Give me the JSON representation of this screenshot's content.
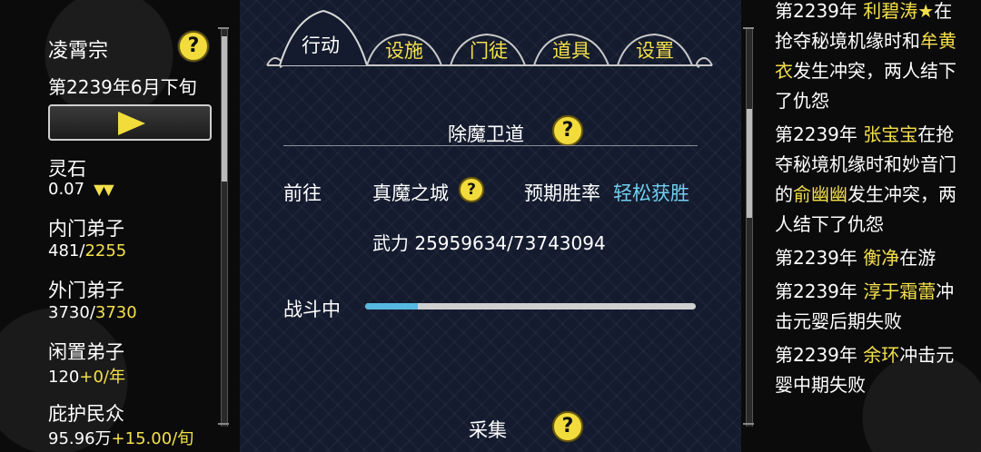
{
  "sidebar": {
    "sect_name": "凌霄宗",
    "date": "第2239年6月下旬",
    "stats": [
      {
        "label": "灵石",
        "value": "0.07",
        "extra": "▼▼"
      },
      {
        "label": "内门弟子",
        "current": "481",
        "sep": "/",
        "max": "2255"
      },
      {
        "label": "外门弟子",
        "current": "3730",
        "sep": "/",
        "max": "3730"
      },
      {
        "label": "闲置弟子",
        "current": "120",
        "delta": "+0/年"
      },
      {
        "label": "庇护民众",
        "current": "95.96万",
        "delta": "+15.00/旬"
      }
    ]
  },
  "tabs": [
    {
      "label": "行动",
      "active": true
    },
    {
      "label": "设施",
      "active": false
    },
    {
      "label": "门徒",
      "active": false
    },
    {
      "label": "道具",
      "active": false
    },
    {
      "label": "设置",
      "active": false
    }
  ],
  "mission": {
    "title": "除魔卫道",
    "goto_label": "前往",
    "destination": "真魔之城",
    "win_rate_label": "预期胜率",
    "win_rate_value": "轻松获胜",
    "power_label": "武力",
    "power_value": "25959634/73743094",
    "status_label": "战斗中",
    "progress_fraction": 0.16
  },
  "next_section": {
    "title": "采集"
  },
  "log": [
    {
      "parts": [
        {
          "t": "第2239年 "
        },
        {
          "t": "利碧涛★",
          "hl": true
        },
        {
          "t": "在抢夺秘境机缘时和"
        },
        {
          "t": "牟黄衣",
          "hl": true
        },
        {
          "t": "发生冲突，两人结下了仇怨"
        }
      ]
    },
    {
      "parts": [
        {
          "t": "第2239年 "
        },
        {
          "t": "张宝宝",
          "hl": true
        },
        {
          "t": "在抢夺秘境机缘时和妙音门的"
        },
        {
          "t": "俞幽幽",
          "hl": true
        },
        {
          "t": "发生冲突，两人结下了仇怨"
        }
      ]
    },
    {
      "parts": [
        {
          "t": "第2239年 "
        },
        {
          "t": "衡净",
          "hl": true
        },
        {
          "t": "在游"
        }
      ]
    },
    {
      "parts": [
        {
          "t": "第2239年 "
        },
        {
          "t": "淳于霜蕾",
          "hl": true
        },
        {
          "t": "冲击元婴后期失败"
        }
      ]
    },
    {
      "parts": [
        {
          "t": "第2239年 "
        },
        {
          "t": "余环",
          "hl": true
        },
        {
          "t": "冲击元婴中期失败"
        }
      ]
    }
  ],
  "icons": {
    "help": "?"
  },
  "colors": {
    "accent_yellow": "#f4e04a",
    "cyan": "#6fd0f0",
    "panel_bg": "#141b2e"
  }
}
